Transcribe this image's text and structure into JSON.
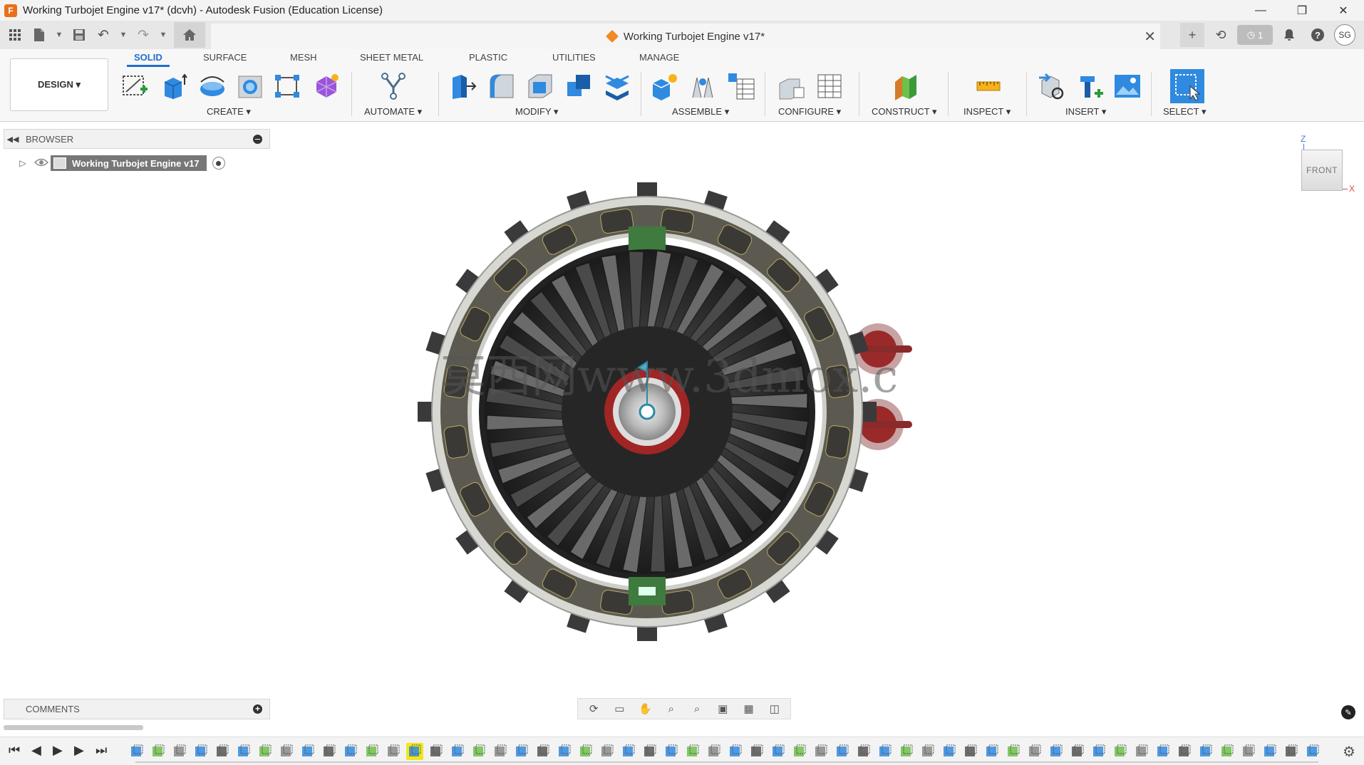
{
  "window": {
    "title": "Working Turbojet Engine v17* (dcvh) - Autodesk Fusion (Education License)",
    "app_icon_letter": "F",
    "minimize": "—",
    "restore": "❐",
    "close": "✕"
  },
  "document_tab": {
    "title": "Working Turbojet Engine v17*",
    "close": "✕"
  },
  "quick_access": {
    "jobs_count": "1",
    "user_initials": "SG"
  },
  "ribbon": {
    "workspace": "DESIGN ▾",
    "tabs": [
      "SOLID",
      "SURFACE",
      "MESH",
      "SHEET METAL",
      "PLASTIC",
      "UTILITIES",
      "MANAGE"
    ],
    "groups": [
      "CREATE ▾",
      "AUTOMATE ▾",
      "MODIFY ▾",
      "ASSEMBLE ▾",
      "CONFIGURE ▾",
      "CONSTRUCT ▾",
      "INSPECT ▾",
      "INSERT ▾",
      "SELECT ▾"
    ]
  },
  "browser": {
    "title": "BROWSER",
    "root_node": "Working Turbojet Engine v17"
  },
  "viewcube": {
    "face": "FRONT",
    "axis_z": "Z",
    "axis_x": "X"
  },
  "comments": {
    "title": "COMMENTS"
  },
  "watermark": "莫西网www.3dmox.c",
  "colors": {
    "accent": "#1f6fcf",
    "timeline_selected": "#f2e51a",
    "model_ring": "#d8d8d2",
    "blade_dark": "#2a2a2a",
    "rim_red": "#9a2a2a"
  }
}
